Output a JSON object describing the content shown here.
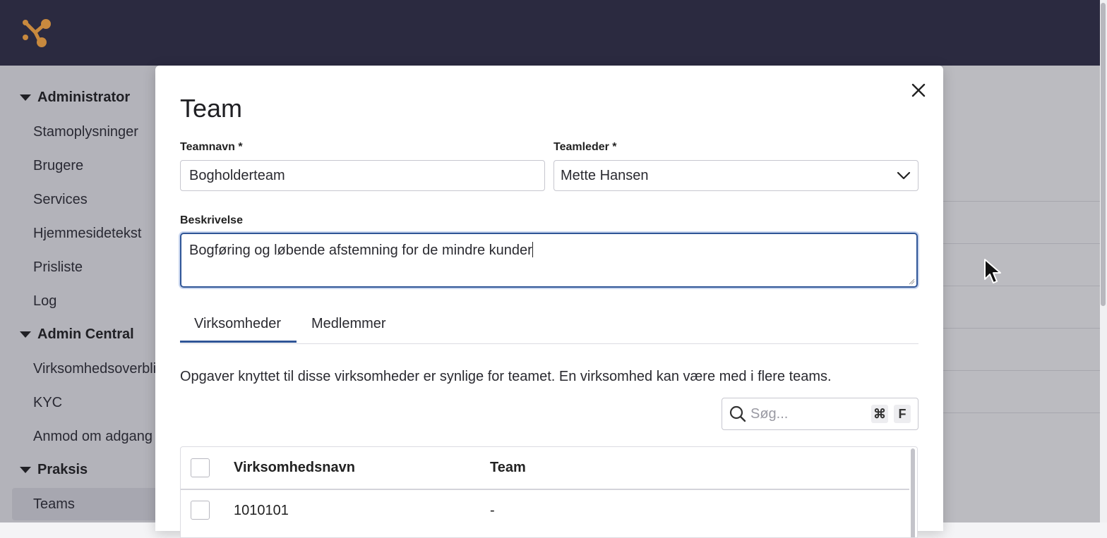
{
  "topbar": {
    "logo": "app-logo-icon"
  },
  "sidebar": {
    "sections": [
      {
        "title": "Administrator",
        "items": [
          "Stamoplysninger",
          "Brugere",
          "Services",
          "Hjemmesidetekst",
          "Prisliste",
          "Log"
        ]
      },
      {
        "title": "Admin Central",
        "items": [
          "Virksomhedsoverblik",
          "KYC",
          "Anmod om adgang"
        ]
      },
      {
        "title": "Praksis",
        "items": [
          "Teams"
        ]
      }
    ],
    "active_item": "Teams"
  },
  "modal": {
    "title": "Team",
    "close_icon": "close-icon",
    "team_name": {
      "label": "Teamnavn *",
      "value": "Bogholderteam"
    },
    "team_lead": {
      "label": "Teamleder *",
      "value": "Mette Hansen"
    },
    "description": {
      "label": "Beskrivelse",
      "value": "Bogføring og løbende afstemning for de mindre kunder"
    },
    "tabs": [
      {
        "label": "Virksomheder",
        "active": true
      },
      {
        "label": "Medlemmer",
        "active": false
      }
    ],
    "info_text": "Opgaver knyttet til disse virksomheder er synlige for teamet. En virksomhed kan være med i flere teams.",
    "search": {
      "placeholder": "Søg...",
      "shortcut_mod": "⌘",
      "shortcut_key": "F"
    },
    "table": {
      "columns": [
        "Virksomhedsnavn",
        "Team"
      ],
      "rows": [
        {
          "name": "1010101",
          "team": "-"
        }
      ]
    }
  },
  "colors": {
    "topbar": "#2b2a40",
    "accent": "#2f5597",
    "logo": "#c8893e"
  }
}
